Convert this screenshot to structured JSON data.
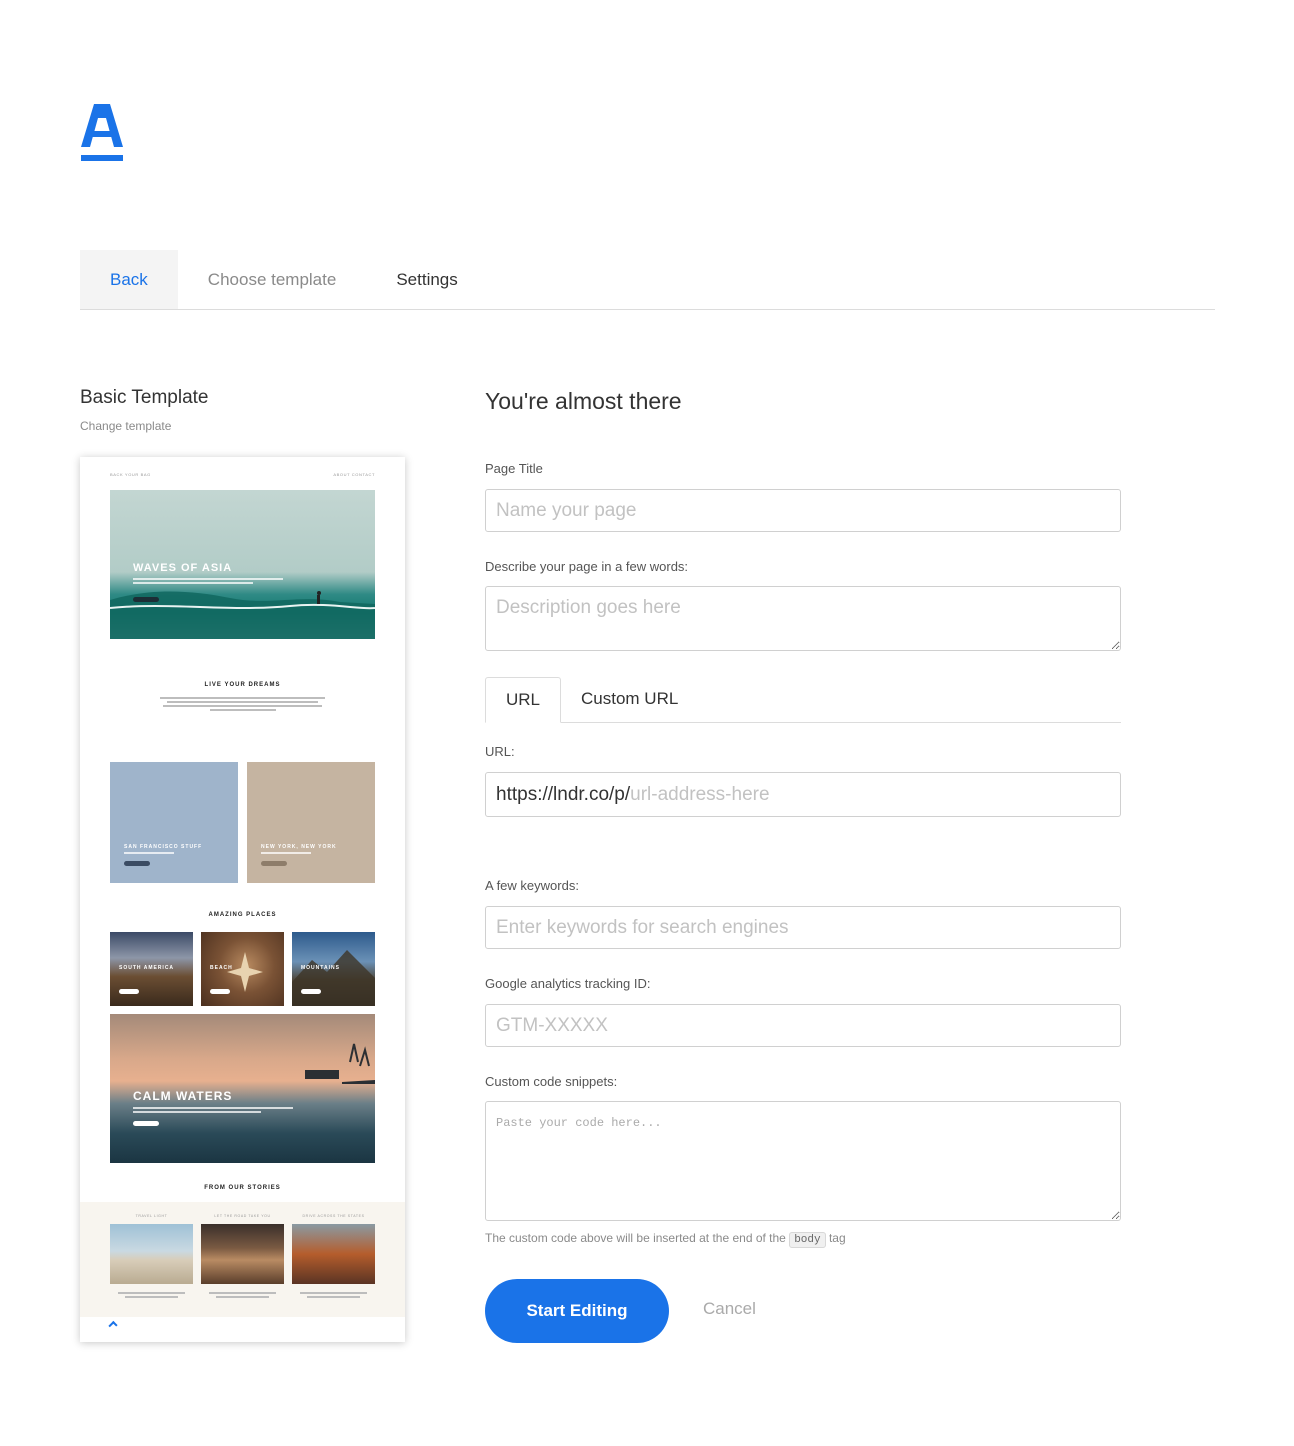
{
  "brand": {
    "logo_icon": "a-logo-icon",
    "accent_color": "#1a73e8"
  },
  "nav": {
    "back": "Back",
    "choose_template": "Choose template",
    "settings": "Settings"
  },
  "template": {
    "title": "Basic Template",
    "change_link": "Change template",
    "preview": {
      "nav_left": "BACK YOUR BAG",
      "nav_right": "ABOUT  CONTACT",
      "hero_title": "WAVES OF ASIA",
      "section1": "LIVE YOUR DREAMS",
      "card1": "SAN FRANCISCO STUFF",
      "card2": "NEW YORK, NEW YORK",
      "section2": "AMAZING PLACES",
      "place1": "SOUTH AMERICA",
      "place2": "BEACH",
      "place3": "MOUNTAINS",
      "banner": "CALM WATERS",
      "section3": "FROM OUR STORIES",
      "story1": "TRAVEL LIGHT",
      "story2": "LET THE ROAD TAKE YOU",
      "story3": "DRIVE ACROSS THE STATES"
    }
  },
  "form": {
    "heading": "You're almost there",
    "page_title_label": "Page Title",
    "page_title_placeholder": "Name your page",
    "description_label": "Describe your page in a few words:",
    "description_placeholder": "Description goes here",
    "url_tabs": [
      "URL",
      "Custom URL"
    ],
    "url_label": "URL:",
    "url_prefix": "https://lndr.co/p/",
    "url_placeholder": "url-address-here",
    "keywords_label": "A few keywords:",
    "keywords_placeholder": "Enter keywords for search engines",
    "ga_label": "Google analytics tracking ID:",
    "ga_placeholder": "GTM-XXXXX",
    "code_label": "Custom code snippets:",
    "code_placeholder": "Paste your code here...",
    "code_note_before": "The custom code above will be inserted at the end of the",
    "code_note_tag": "body",
    "code_note_after": "tag",
    "start_button": "Start Editing",
    "cancel_button": "Cancel"
  }
}
